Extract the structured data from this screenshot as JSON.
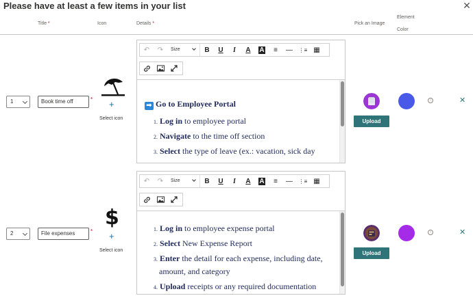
{
  "dialog": {
    "title": "Please have at least a few items in your list",
    "close_glyph": "✕"
  },
  "columns": {
    "title": "Title",
    "icon": "Icon",
    "details": "Details",
    "pick_image": "Pick an Image",
    "element": "Element",
    "color": "Color",
    "required_mark": "*"
  },
  "toolbar": {
    "undo": "↶",
    "redo": "↷",
    "size_label": "Size",
    "bold": "B",
    "underline": "U",
    "italic": "I",
    "font_color": "A",
    "highlight": "A",
    "align": "≡",
    "hr": "—",
    "numbered_list": "⋮≡",
    "table": "▦",
    "link": "🔗",
    "image": "▣",
    "expand": "⤢"
  },
  "rows": [
    {
      "number": "1",
      "title_value": "Book time off",
      "icon_name": "beach-umbrella-icon",
      "plus": "+",
      "select_icon": "Select icon",
      "details": {
        "heading_icon": "➡️",
        "heading": "Go to Employee Portal",
        "items": [
          {
            "n": "1.",
            "bold": "Log in",
            "rest": " to employee portal"
          },
          {
            "n": "2.",
            "bold": "Navigate",
            "rest": " to the time off section"
          },
          {
            "n": "3.",
            "bold": "Select",
            "rest": " the type of leave (ex.: vacation, sick day"
          }
        ]
      },
      "upload_label": "Upload",
      "color": "#4a5ae8"
    },
    {
      "number": "2",
      "title_value": "File expenses",
      "icon_name": "dollar-sign-icon",
      "icon_glyph": "$",
      "plus": "+",
      "select_icon": "Select icon",
      "details": {
        "items": [
          {
            "n": "1.",
            "bold": "Log in",
            "rest": " to employee expense portal"
          },
          {
            "n": "2.",
            "bold": "Select",
            "rest": " New Expense Report"
          },
          {
            "n": "3.",
            "bold": "Enter",
            "rest": " the detail for each expense, including date,"
          },
          {
            "n": "",
            "bold": "",
            "rest": "amount, and category"
          },
          {
            "n": "4.",
            "bold": "Upload",
            "rest": " receipts or any required documentation"
          }
        ]
      },
      "upload_label": "Upload",
      "color": "#a62be8"
    }
  ]
}
